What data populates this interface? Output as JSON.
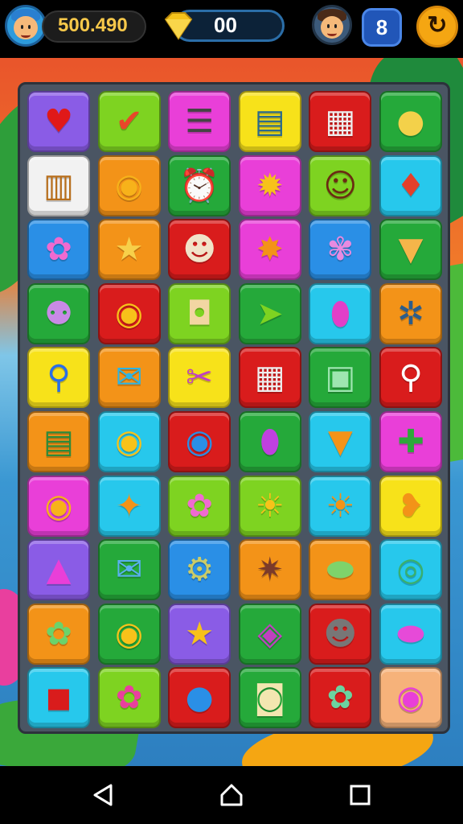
{
  "hud": {
    "coins": "500.490",
    "gems": "00",
    "lives": "8",
    "refresh_icon": "refresh-icon",
    "player_avatar": "player-avatar",
    "opponent_avatar": "friend-avatar"
  },
  "colors": {
    "purple": "#8a5ce6",
    "lime": "#7ed321",
    "magenta": "#e93fd8",
    "yellow": "#f7e21a",
    "red": "#d91c1c",
    "green": "#25a93a",
    "white": "#f2f2f2",
    "orange": "#f39318",
    "blue": "#2a8fe6",
    "cyan": "#27c8ec",
    "peach": "#f6b27a"
  },
  "board": {
    "rows": [
      [
        {
          "color": "purple",
          "icon": "heart-icon",
          "glyph": "♥",
          "fg": "#e01919"
        },
        {
          "color": "lime",
          "icon": "checkmark-icon",
          "glyph": "✔",
          "fg": "#e8472a"
        },
        {
          "color": "magenta",
          "icon": "list-icon",
          "glyph": "☰",
          "fg": "#444"
        },
        {
          "color": "yellow",
          "icon": "tablet-icon",
          "glyph": "▤",
          "fg": "#2c6a8c"
        },
        {
          "color": "red",
          "icon": "clipboard-icon",
          "glyph": "▦",
          "fg": "#eee"
        },
        {
          "color": "green",
          "icon": "speech-bubble-icon",
          "glyph": "●",
          "fg": "#f3d14a"
        }
      ],
      [
        {
          "color": "white",
          "icon": "book-stack-icon",
          "glyph": "▥",
          "fg": "#b86f1c"
        },
        {
          "color": "orange",
          "icon": "fish-icon",
          "glyph": "◉",
          "fg": "#f7b21a"
        },
        {
          "color": "green",
          "icon": "alarm-clock-icon",
          "glyph": "⏰",
          "fg": "#e82222"
        },
        {
          "color": "magenta",
          "icon": "creature-icon",
          "glyph": "✹",
          "fg": "#f7c21a"
        },
        {
          "color": "lime",
          "icon": "character-icon",
          "glyph": "☺",
          "fg": "#6b2a12"
        },
        {
          "color": "cyan",
          "icon": "microphone-icon",
          "glyph": "♦",
          "fg": "#e3402a"
        }
      ],
      [
        {
          "color": "blue",
          "icon": "monster-icon",
          "glyph": "✿",
          "fg": "#f06ad0"
        },
        {
          "color": "orange",
          "icon": "star-character-icon",
          "glyph": "★",
          "fg": "#f7d04a"
        },
        {
          "color": "red",
          "icon": "chef-icon",
          "glyph": "☻",
          "fg": "#f1e3c9"
        },
        {
          "color": "magenta",
          "icon": "dragon-icon",
          "glyph": "✸",
          "fg": "#f39318"
        },
        {
          "color": "blue",
          "icon": "alien-icon",
          "glyph": "✾",
          "fg": "#e88ae0"
        },
        {
          "color": "green",
          "icon": "ice-cream-icon",
          "glyph": "▼",
          "fg": "#f5b54a"
        }
      ],
      [
        {
          "color": "green",
          "icon": "bone-icon",
          "glyph": "⚉",
          "fg": "#c88ae6"
        },
        {
          "color": "red",
          "icon": "fish-icon",
          "glyph": "◉",
          "fg": "#f7c21a"
        },
        {
          "color": "lime",
          "icon": "cup-icon",
          "glyph": "◘",
          "fg": "#f2d6a2"
        },
        {
          "color": "green",
          "icon": "fish-icon",
          "glyph": "➤",
          "fg": "#7ed321"
        },
        {
          "color": "cyan",
          "icon": "jar-icon",
          "glyph": "⬮",
          "fg": "#e23fc8"
        },
        {
          "color": "orange",
          "icon": "gear-icon",
          "glyph": "✲",
          "fg": "#2c5d8a"
        }
      ],
      [
        {
          "color": "yellow",
          "icon": "magnifier-icon",
          "glyph": "⚲",
          "fg": "#2a6ee6"
        },
        {
          "color": "orange",
          "icon": "envelope-icon",
          "glyph": "✉",
          "fg": "#2ab5e6"
        },
        {
          "color": "yellow",
          "icon": "tools-icon",
          "glyph": "✂",
          "fg": "#c040c0"
        },
        {
          "color": "red",
          "icon": "clipboard-icon",
          "glyph": "▦",
          "fg": "#eee"
        },
        {
          "color": "green",
          "icon": "briefcase-icon",
          "glyph": "▣",
          "fg": "#9ee6b0"
        },
        {
          "color": "red",
          "icon": "tool-icon",
          "glyph": "⚲",
          "fg": "#ffffff"
        }
      ],
      [
        {
          "color": "orange",
          "icon": "notebook-icon",
          "glyph": "▤",
          "fg": "#2e8a3a"
        },
        {
          "color": "cyan",
          "icon": "fish-icon",
          "glyph": "◉",
          "fg": "#f7c21a"
        },
        {
          "color": "red",
          "icon": "blue-fish-icon",
          "glyph": "◉",
          "fg": "#2a8fe6"
        },
        {
          "color": "green",
          "icon": "potion-icon",
          "glyph": "⬮",
          "fg": "#c040e0"
        },
        {
          "color": "cyan",
          "icon": "ice-cream-icon",
          "glyph": "▼",
          "fg": "#f39318"
        },
        {
          "color": "magenta",
          "icon": "hammer-icon",
          "glyph": "✚",
          "fg": "#2ea83a"
        }
      ],
      [
        {
          "color": "magenta",
          "icon": "fish-icon",
          "glyph": "◉",
          "fg": "#f7b21a"
        },
        {
          "color": "cyan",
          "icon": "creature-icon",
          "glyph": "✦",
          "fg": "#f39318"
        },
        {
          "color": "lime",
          "icon": "pink-creature-icon",
          "glyph": "✿",
          "fg": "#f06ad0"
        },
        {
          "color": "lime",
          "icon": "sun-icon",
          "glyph": "☀",
          "fg": "#f7c21a"
        },
        {
          "color": "cyan",
          "icon": "sun-icon",
          "glyph": "☀",
          "fg": "#f39318"
        },
        {
          "color": "yellow",
          "icon": "chick-icon",
          "glyph": "❥",
          "fg": "#f39318"
        }
      ],
      [
        {
          "color": "purple",
          "icon": "triangle-icon",
          "glyph": "▲",
          "fg": "#e93fd8"
        },
        {
          "color": "green",
          "icon": "envelope-icon",
          "glyph": "✉",
          "fg": "#5ab0f0"
        },
        {
          "color": "blue",
          "icon": "ring-icon",
          "glyph": "⚙",
          "fg": "#cccc66"
        },
        {
          "color": "orange",
          "icon": "cat-icon",
          "glyph": "✷",
          "fg": "#7a3a2a"
        },
        {
          "color": "orange",
          "icon": "slime-icon",
          "glyph": "⬬",
          "fg": "#7ed36b"
        },
        {
          "color": "cyan",
          "icon": "speech-bubble-icon",
          "glyph": "◎",
          "fg": "#3ab06b"
        }
      ],
      [
        {
          "color": "orange",
          "icon": "blob-icon",
          "glyph": "✿",
          "fg": "#6bd36b"
        },
        {
          "color": "green",
          "icon": "fish-icon",
          "glyph": "◉",
          "fg": "#f7c21a"
        },
        {
          "color": "purple",
          "icon": "star-icon",
          "glyph": "★",
          "fg": "#f7c21a"
        },
        {
          "color": "green",
          "icon": "ticket-icon",
          "glyph": "◈",
          "fg": "#c040c0"
        },
        {
          "color": "red",
          "icon": "robot-icon",
          "glyph": "☻",
          "fg": "#777"
        },
        {
          "color": "cyan",
          "icon": "ufo-icon",
          "glyph": "⬬",
          "fg": "#e64ad8"
        }
      ],
      [
        {
          "color": "cyan",
          "icon": "cube-icon",
          "glyph": "◼",
          "fg": "#d91c1c"
        },
        {
          "color": "lime",
          "icon": "candy-icon",
          "glyph": "✿",
          "fg": "#e93f9e"
        },
        {
          "color": "red",
          "icon": "globe-icon",
          "glyph": "●",
          "fg": "#2a8fe6"
        },
        {
          "color": "green",
          "icon": "bucket-icon",
          "glyph": "◙",
          "fg": "#f2e6b0"
        },
        {
          "color": "red",
          "icon": "slime-icon",
          "glyph": "✿",
          "fg": "#6bd3a0"
        },
        {
          "color": "peach",
          "icon": "orb-icon",
          "glyph": "◉",
          "fg": "#e93fd8"
        }
      ]
    ]
  },
  "nav": {
    "back_icon": "back-icon",
    "home_icon": "home-icon",
    "recents_icon": "recents-icon"
  }
}
